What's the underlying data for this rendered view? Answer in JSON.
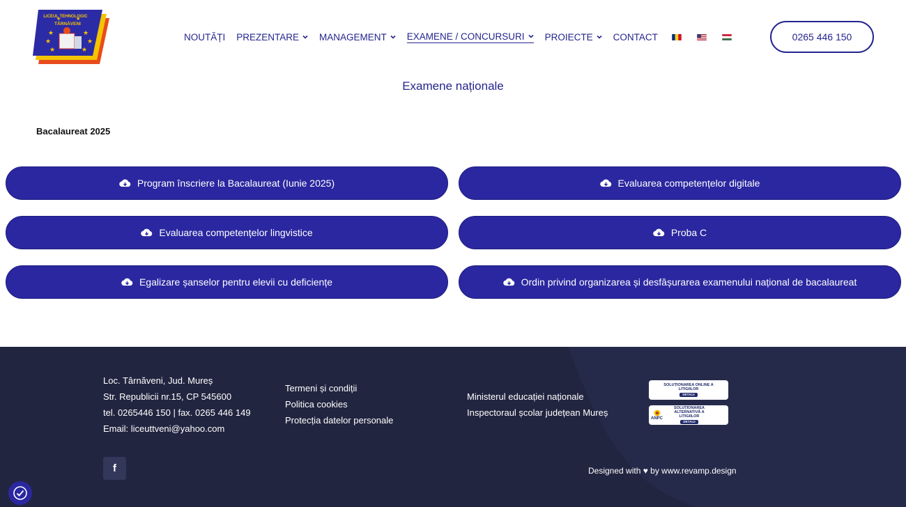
{
  "header": {
    "logo": {
      "top_text": "LICEUL TEHNOLOGIC",
      "bottom_text": "TÂRNĂVENI"
    },
    "nav": [
      {
        "label": "NOUTĂȚI",
        "has_dropdown": false,
        "active": false
      },
      {
        "label": "PREZENTARE",
        "has_dropdown": true,
        "active": false
      },
      {
        "label": "MANAGEMENT",
        "has_dropdown": true,
        "active": false
      },
      {
        "label": "EXAMENE / CONCURSURI",
        "has_dropdown": true,
        "active": true
      },
      {
        "label": "PROIECTE",
        "has_dropdown": true,
        "active": false
      },
      {
        "label": "CONTACT",
        "has_dropdown": false,
        "active": false
      }
    ],
    "flags": [
      "flag-romania-icon",
      "flag-usa-icon",
      "flag-hungary-icon"
    ],
    "phone": "0265 446 150"
  },
  "main": {
    "page_title": "Examene naționale",
    "section_title": "Bacalaureat 2025",
    "buttons": [
      {
        "label": "Program înscriere la Bacalaureat (Iunie 2025)",
        "icon": "cloud-download-icon"
      },
      {
        "label": "Evaluarea competențelor digitale",
        "icon": "cloud-download-icon"
      },
      {
        "label": "Evaluarea competențelor lingvistice",
        "icon": "cloud-download-icon"
      },
      {
        "label": "Proba C",
        "icon": "cloud-download-icon"
      },
      {
        "label": "Egalizare șanselor pentru elevii cu deficiențe",
        "icon": "cloud-download-icon"
      },
      {
        "label": "Ordin privind organizarea și desfășurarea examenului național de bacalaureat",
        "icon": "cloud-download-icon"
      }
    ]
  },
  "footer": {
    "address": [
      "Loc. Târnăveni, Jud. Mureș",
      "Str. Republicii nr.15, CP 545600",
      "tel. 0265446 150 | fax. 0265 446 149",
      "Email: liceuttveni@yahoo.com"
    ],
    "legal_links": [
      "Termeni și condiții",
      "Politica cookies",
      "Protecția datelor personale"
    ],
    "institution_links": [
      "Ministerul educației naționale",
      "Inspectoraul școlar județean Mureș"
    ],
    "badge_sol": {
      "text": "SOLUȚIONAREA ONLINE A LITIGIILOR",
      "detail": "DETALII"
    },
    "badge_anpc": {
      "logo_text": "ANPC",
      "text": "SOLUȚIONAREA ALTERNATIVĂ A LITIGIILOR",
      "detail": "DETALII"
    },
    "social": {
      "facebook": "f"
    },
    "credit": "Designed with ♥ by www.revamp.design"
  },
  "colors": {
    "primary": "#2a27a0",
    "nav_text": "#24248f",
    "footer_bg": "#222540"
  }
}
